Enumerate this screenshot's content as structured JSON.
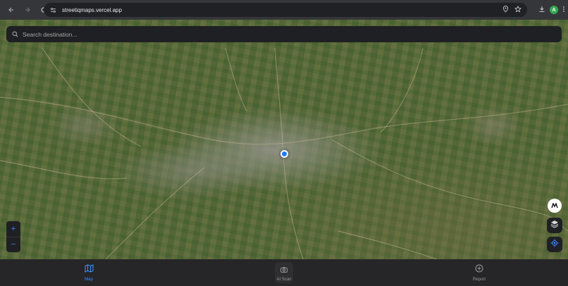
{
  "browser": {
    "url": "streetiqmaps.vercel.app",
    "profile_initial": "A"
  },
  "search": {
    "placeholder": "Search destination..."
  },
  "zoom": {
    "in_label": "+",
    "out_label": "−"
  },
  "nav": {
    "items": [
      {
        "label": "Map",
        "icon": "map-icon",
        "active": true
      },
      {
        "label": "AI Scan",
        "icon": "camera-icon",
        "active": false
      },
      {
        "label": "Report",
        "icon": "plus-circle-icon",
        "active": false
      }
    ]
  },
  "colors": {
    "accent": "#3d8bff",
    "location_dot": "#1e7bff"
  }
}
